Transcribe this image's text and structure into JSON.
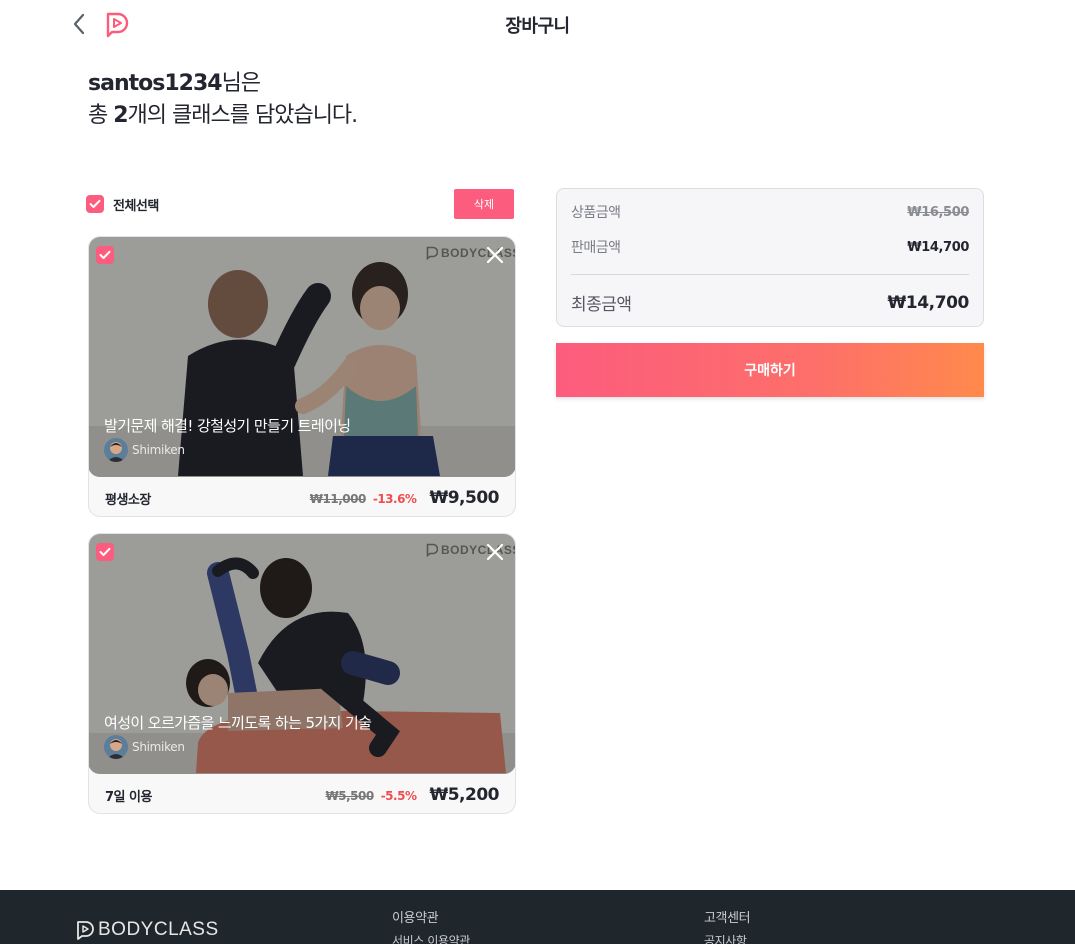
{
  "header": {
    "title": "장바구니"
  },
  "greeting": {
    "username": "santos1234",
    "suffix": "님은",
    "line2_prefix": "총 ",
    "count": "2",
    "line2_suffix": "개의 클래스를 담았습니다."
  },
  "selection": {
    "select_all_label": "전체선택",
    "delete_label": "삭제"
  },
  "cart_items": [
    {
      "title": "발기문제 해결! 강철성기 만들기 트레이닝",
      "author": "Shimiken",
      "plan": "평생소장",
      "original_price": "₩11,000",
      "discount": "-13.6%",
      "final_price": "₩9,500",
      "watermark": "BODYCLASS"
    },
    {
      "title": "여성이 오르가즘을 느끼도록 하는 5가지 기술",
      "author": "Shimiken",
      "plan": "7일 이용",
      "original_price": "₩5,500",
      "discount": "-5.5%",
      "final_price": "₩5,200",
      "watermark": "BODYCLASS"
    }
  ],
  "summary": {
    "product_label": "상품금액",
    "product_value": "₩16,500",
    "sale_label": "판매금액",
    "sale_value": "₩14,700",
    "total_label": "최종금액",
    "total_value": "₩14,700"
  },
  "buy_button": "구매하기",
  "footer": {
    "logo": "BODYCLASS",
    "col1_heading": "이용약관",
    "col1_link": "서비스 이용약관",
    "col2_heading": "고객센터",
    "col2_link": "공지사항"
  },
  "colors": {
    "accent": "#fc5c7d",
    "gradient_end": "#ff8a4c",
    "footer_bg": "#1f262c",
    "discount": "#f04e4e"
  },
  "icons": [
    "chevron-left-icon",
    "bodyclass-logo-icon",
    "check-icon",
    "close-icon"
  ]
}
